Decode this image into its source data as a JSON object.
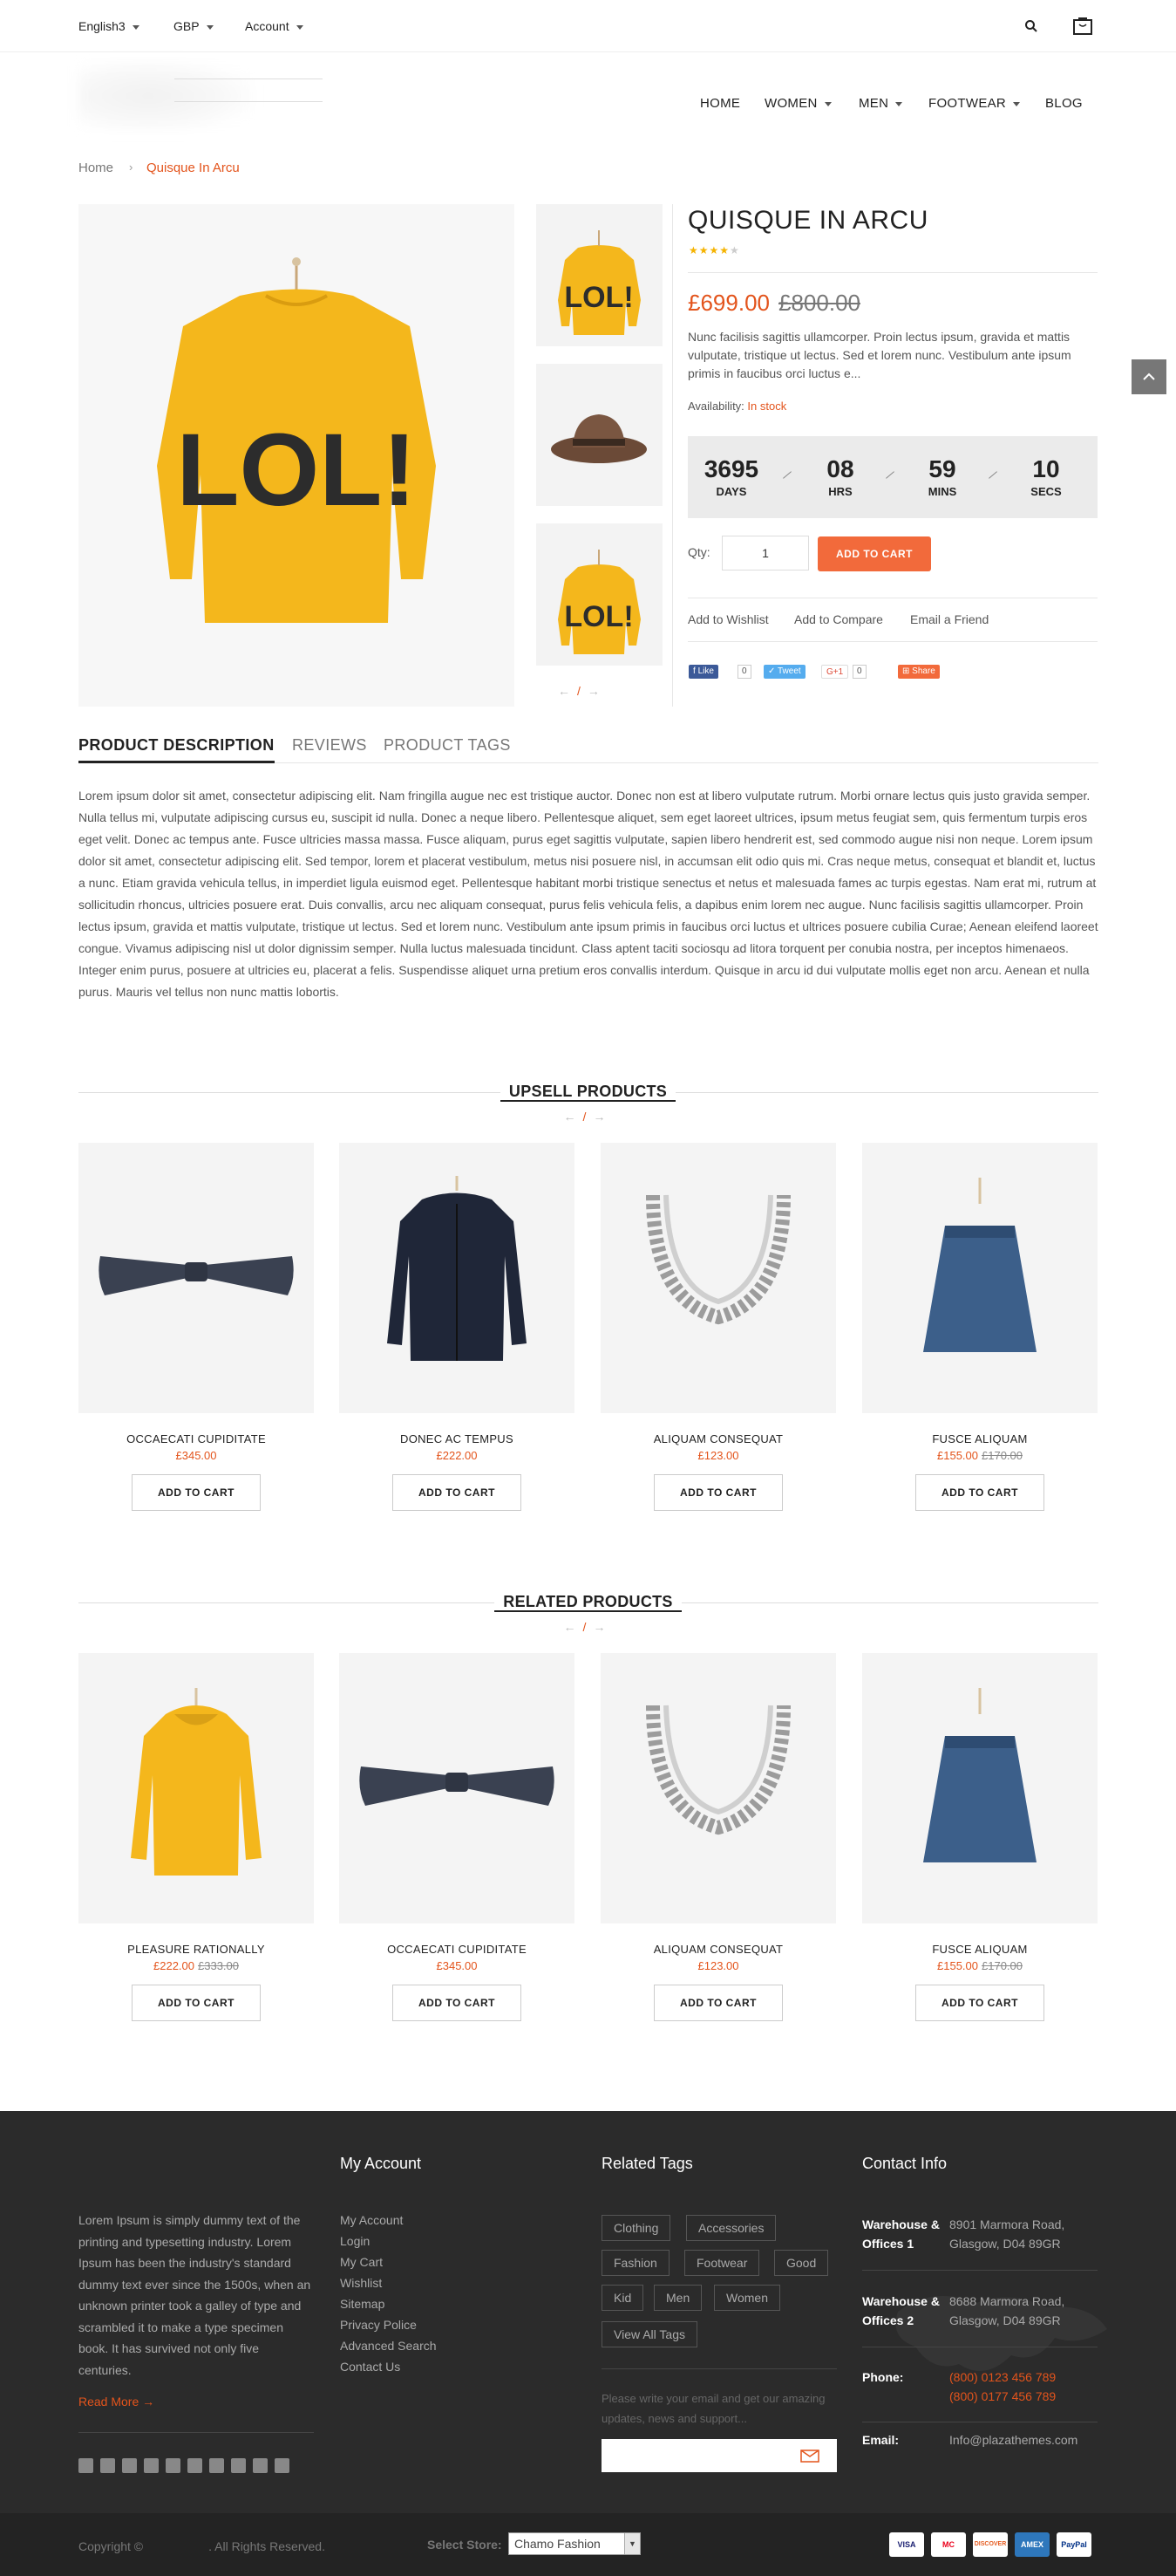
{
  "topbar": {
    "language": "English3",
    "currency": "GBP",
    "account": "Account"
  },
  "nav": {
    "items": [
      "HOME",
      "WOMEN",
      "MEN",
      "FOOTWEAR",
      "BLOG"
    ]
  },
  "breadcrumb": {
    "home": "Home",
    "current": "Quisque In Arcu"
  },
  "product": {
    "title": "QUISQUE IN ARCU",
    "rating": 4,
    "price_new": "£699.00",
    "price_old": "£800.00",
    "short_desc": "Nunc facilisis sagittis ullamcorper. Proin lectus ipsum, gravida et mattis vulputate, tristique ut lectus. Sed et lorem nunc. Vestibulum ante ipsum primis in faucibus orci luctus e...",
    "availability_label": "Availability:",
    "availability_value": "In stock",
    "timer": [
      {
        "value": "3695",
        "label": "DAYS"
      },
      {
        "value": "08",
        "label": "HRS"
      },
      {
        "value": "59",
        "label": "MINS"
      },
      {
        "value": "10",
        "label": "SECS"
      }
    ],
    "qty_label": "Qty:",
    "qty": "1",
    "add_to_cart": "ADD TO CART",
    "links": [
      "Add to Wishlist",
      "Add to Compare",
      "Email a Friend"
    ],
    "social": {
      "like": "Like",
      "like_count": "0",
      "tweet": "Tweet",
      "gplus": "G+1",
      "gplus_count": "0",
      "share": "Share"
    }
  },
  "tabs": [
    "PRODUCT DESCRIPTION",
    "REVIEWS",
    "PRODUCT TAGS"
  ],
  "description": "Lorem ipsum dolor sit amet, consectetur adipiscing elit. Nam fringilla augue nec est tristique auctor. Donec non est at libero vulputate rutrum. Morbi ornare lectus quis justo gravida semper. Nulla tellus mi, vulputate adipiscing cursus eu, suscipit id nulla. Donec a neque libero. Pellentesque aliquet, sem eget laoreet ultrices, ipsum metus feugiat sem, quis fermentum turpis eros eget velit. Donec ac tempus ante. Fusce ultricies massa massa. Fusce aliquam, purus eget sagittis vulputate, sapien libero hendrerit est, sed commodo augue nisi non neque. Lorem ipsum dolor sit amet, consectetur adipiscing elit. Sed tempor, lorem et placerat vestibulum, metus nisi posuere nisl, in accumsan elit odio quis mi. Cras neque metus, consequat et blandit et, luctus a nunc. Etiam gravida vehicula tellus, in imperdiet ligula euismod eget. Pellentesque habitant morbi tristique senectus et netus et malesuada fames ac turpis egestas. Nam erat mi, rutrum at sollicitudin rhoncus, ultricies posuere erat. Duis convallis, arcu nec aliquam consequat, purus felis vehicula felis, a dapibus enim lorem nec augue. Nunc facilisis sagittis ullamcorper. Proin lectus ipsum, gravida et mattis vulputate, tristique ut lectus. Sed et lorem nunc. Vestibulum ante ipsum primis in faucibus orci luctus et ultrices posuere cubilia Curae; Aenean eleifend laoreet congue. Vivamus adipiscing nisl ut dolor dignissim semper. Nulla luctus malesuada tincidunt. Class aptent taciti sociosqu ad litora torquent per conubia nostra, per inceptos himenaeos. Integer enim purus, posuere at ultricies eu, placerat a felis. Suspendisse aliquet urna pretium eros convallis interdum. Quisque in arcu id dui vulputate mollis eget non arcu. Aenean et nulla purus. Mauris vel tellus non nunc mattis lobortis.",
  "upsell": {
    "title": "UPSELL PRODUCTS",
    "items": [
      {
        "name": "OCCAECATI CUPIDITATE",
        "price": "£345.00",
        "old": "",
        "button": "ADD TO CART",
        "image": "bowtie"
      },
      {
        "name": "DONEC AC TEMPUS",
        "price": "£222.00",
        "old": "",
        "button": "ADD TO CART",
        "image": "jacket"
      },
      {
        "name": "ALIQUAM CONSEQUAT",
        "price": "£123.00",
        "old": "",
        "button": "ADD TO CART",
        "image": "necklace"
      },
      {
        "name": "FUSCE ALIQUAM",
        "price": "£155.00",
        "old": "£170.00",
        "button": "ADD TO CART",
        "image": "skirt"
      }
    ]
  },
  "related": {
    "title": "RELATED PRODUCTS",
    "items": [
      {
        "name": "PLEASURE RATIONALLY",
        "price": "£222.00",
        "old": "£333.00",
        "button": "ADD TO CART",
        "image": "raincoat"
      },
      {
        "name": "OCCAECATI CUPIDITATE",
        "price": "£345.00",
        "old": "",
        "button": "ADD TO CART",
        "image": "bowtie"
      },
      {
        "name": "ALIQUAM CONSEQUAT",
        "price": "£123.00",
        "old": "",
        "button": "ADD TO CART",
        "image": "necklace"
      },
      {
        "name": "FUSCE ALIQUAM",
        "price": "£155.00",
        "old": "£170.00",
        "button": "ADD TO CART",
        "image": "skirt"
      }
    ]
  },
  "footer": {
    "about": "Lorem Ipsum is simply dummy text of the printing and typesetting industry. Lorem Ipsum has been the industry's standard dummy text ever since the 1500s, when an unknown printer took a galley of type and scrambled it to make a type specimen book. It has survived not only five centuries.",
    "read_more": "Read More",
    "account_title": "My Account",
    "account_links": [
      "My Account",
      "Login",
      "My Cart",
      "Wishlist",
      "Sitemap",
      "Privacy Police",
      "Advanced Search",
      "Contact Us"
    ],
    "tags_title": "Related Tags",
    "tags": [
      "Clothing",
      "Accessories",
      "Fashion",
      "Footwear",
      "Good",
      "Kid",
      "Men",
      "Women",
      "View All Tags"
    ],
    "newsletter_note": "Please write your email and get our amazing updates, news and support...",
    "contact_title": "Contact Info",
    "contacts": [
      {
        "label": "Warehouse & Offices 1",
        "value": "8901 Marmora Road, Glasgow, D04 89GR"
      },
      {
        "label": "Warehouse & Offices 2",
        "value": "8688 Marmora Road, Glasgow, D04 89GR"
      },
      {
        "label": "Phone:",
        "value": "(800) 0123 456 789 (800) 0177 456 789"
      },
      {
        "label": "Email:",
        "value": "Info@plazathemes.com"
      }
    ],
    "social_icons": [
      "facebook-icon",
      "twitter-icon",
      "instagram-icon",
      "linkedin-icon",
      "youtube-icon",
      "pinterest-icon",
      "flickr-icon",
      "tumblr-icon",
      "behance-icon",
      "vimeo-icon"
    ],
    "copyright": "Copyright ©",
    "rights": ". All Rights Reserved.",
    "select_store_label": "Select Store:",
    "store": "Chamo Fashion",
    "payments": [
      "VISA",
      "MC",
      "DISCOVER",
      "AMEX",
      "PayPal"
    ]
  },
  "colors": {
    "accent": "#e3541c",
    "cart_button": "#f26a3b",
    "footer": "#2b2b2b",
    "star": "#f5b301"
  }
}
